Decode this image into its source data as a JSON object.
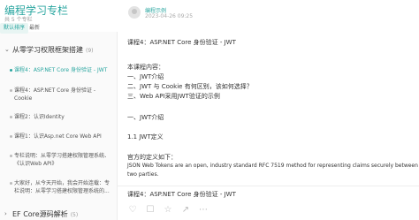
{
  "sidebar": {
    "title": "编程学习专栏",
    "count": "共 5 个专栏",
    "sort_default": "默认排序",
    "sort_latest": "最新",
    "group1": {
      "chevron": "⌄",
      "label": "从零学习权限框架搭建",
      "count": "(9)"
    },
    "items": [
      {
        "label": "课程4：ASP.NET Core 身份验证 - JWT"
      },
      {
        "label": "课程4：ASP.NET Core 身份验证 - Cookie"
      },
      {
        "label": "课程2：认识Identity"
      },
      {
        "label": "课程1：认识Asp.net Core Web API"
      },
      {
        "label": "专栏说明：从零学习搭建权限管理系统、《认识Web API》"
      },
      {
        "label": "大家好，从今天开始，我会开始连载：专栏说明：从零学习搭建权限管理系统的..."
      }
    ],
    "group2": {
      "chevron": "›",
      "label": "EF Core源码解析",
      "count": "(5)"
    }
  },
  "article": {
    "author": "编程示例",
    "date": "2023-04-26 09:25",
    "title": "课程4：ASP.NET Core 身份验证 - JWT",
    "contents_label": "本课程内容：",
    "contents": [
      "一、JWT介绍",
      "二、JWT 与 Cookie 有何区别，该如何选择？",
      "三、Web API采用JWT验证的示例"
    ],
    "section1": "一、JWT介绍",
    "sub1": "1.1 JWT定义",
    "def_label": "官方的定义如下：",
    "def_text_1": "JSON Web Tokens are an open, industry standard RFC 7519 method for representing claims securely between",
    "def_text_2": "two parties.",
    "bottom_title": "课程4：ASP.NET Core 身份验证 - JWT"
  },
  "icons": [
    "like-icon",
    "comment-icon",
    "favorite-icon",
    "share-icon",
    "more-icon"
  ],
  "colors": {
    "accent": "#2aa6a0"
  }
}
